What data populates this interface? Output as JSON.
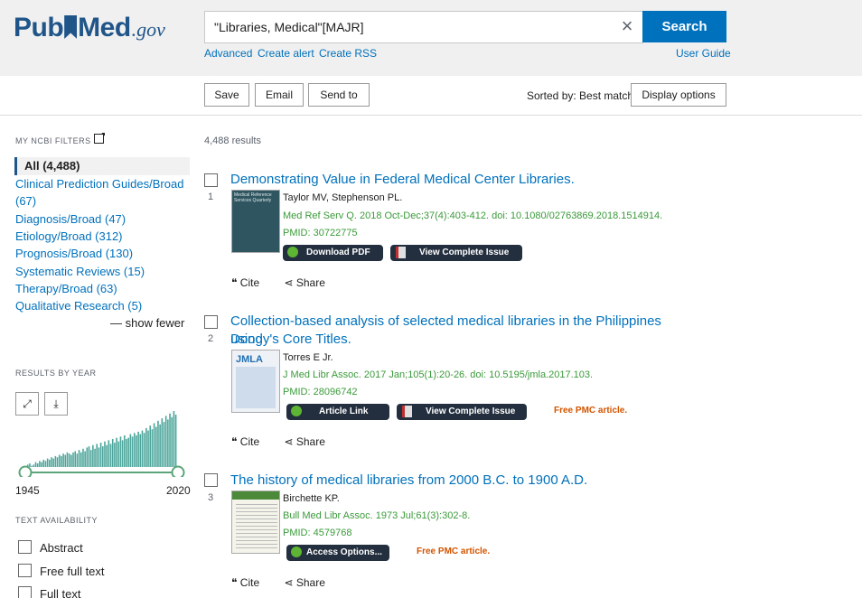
{
  "logo": {
    "pub": "Pub",
    "med": "Med",
    "gov": ".gov"
  },
  "search": {
    "value": "\"Libraries, Medical\"[MAJR]",
    "button": "Search",
    "clear": "×"
  },
  "sublinks": {
    "advanced": "Advanced",
    "create_alert": "Create alert",
    "create_rss": "Create RSS",
    "user_guide": "User Guide"
  },
  "toolbar": {
    "save": "Save",
    "email": "Email",
    "send_to": "Send to",
    "sorted_by": "Sorted by: Best match",
    "display_options": "Display options"
  },
  "sidebar": {
    "ncbi_filters": "MY NCBI FILTERS",
    "filter_all": "All (4,488)",
    "filters": [
      "Clinical Prediction Guides/Broad",
      "(67)",
      "Diagnosis/Broad (47)",
      "Etiology/Broad (312)",
      "Prognosis/Broad (130)",
      "Systematic Reviews (15)",
      "Therapy/Broad (63)",
      "Qualitative Research (5)"
    ],
    "show_fewer": "— show fewer",
    "results_by_year": "RESULTS BY YEAR",
    "year_start": "1945",
    "year_end": "2020",
    "text_availability": "TEXT AVAILABILITY",
    "text_options": [
      "Abstract",
      "Free full text",
      "Full text"
    ]
  },
  "results": {
    "count": "4,488 results",
    "items": [
      {
        "num": "1",
        "title_line1": "Demonstrating Value in Federal Medical Center Libraries.",
        "title_line2": "",
        "authors": "Taylor MV, Stephenson PL.",
        "citation": "Med Ref Serv Q. 2018 Oct-Dec;37(4):403-412. doi: 10.1080/02763869.2018.1514914.",
        "pmid": "PMID: 30722775",
        "btn1": "Download PDF",
        "btn2": "View Complete Issue",
        "free": ""
      },
      {
        "num": "2",
        "title_line1": "Collection-based analysis of selected medical libraries in the Philippines using",
        "title_line2": "Doody's Core Titles.",
        "authors": "Torres E Jr.",
        "citation": "J Med Libr Assoc. 2017 Jan;105(1):20-26. doi: 10.5195/jmla.2017.103.",
        "pmid": "PMID: 28096742",
        "btn1": "Article Link",
        "btn2": "View Complete Issue",
        "free": "Free PMC article."
      },
      {
        "num": "3",
        "title_line1": "The history of medical libraries from 2000 B.C. to 1900 A.D.",
        "title_line2": "",
        "authors": "Birchette KP.",
        "citation": "Bull Med Libr Assoc. 1973 Jul;61(3):302-8.",
        "pmid": "PMID: 4579768",
        "btn1": "Access Options...",
        "btn2": "",
        "free": "Free PMC article."
      }
    ],
    "cite": "Cite",
    "share": "Share"
  },
  "thumbs": {
    "jmla": "JMLA",
    "mrsq": "Medical Reference Services Quarterly"
  },
  "year_bars": [
    2,
    3,
    1,
    2,
    4,
    3,
    5,
    4,
    6,
    5,
    7,
    6,
    8,
    7,
    9,
    8,
    10,
    9,
    11,
    10,
    12,
    11,
    10,
    12,
    13,
    11,
    14,
    12,
    15,
    13,
    16,
    17,
    14,
    18,
    15,
    19,
    16,
    20,
    17,
    21,
    18,
    22,
    19,
    23,
    20,
    24,
    21,
    25,
    22,
    26,
    23,
    24,
    27,
    25,
    28,
    26,
    29,
    27,
    30,
    28,
    32,
    30,
    34,
    31,
    36,
    33,
    38,
    35,
    40,
    37,
    42,
    39,
    44,
    41,
    46,
    43
  ]
}
